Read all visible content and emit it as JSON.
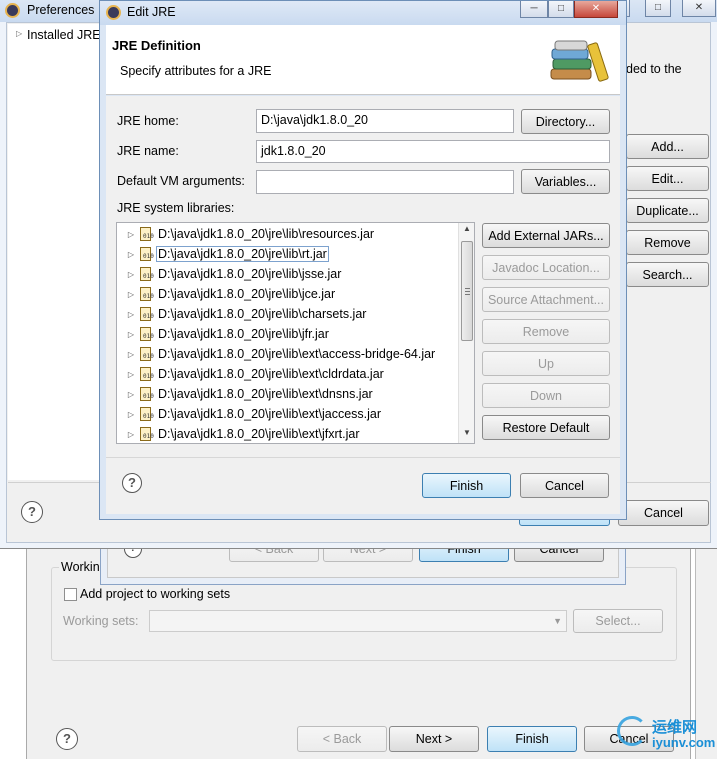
{
  "bg_wizard": {
    "working_sets_group": "Workin",
    "add_project_checkbox": "Add project to working sets",
    "working_sets_label": "Working sets:",
    "select_button": "Select...",
    "back_button": "< Back",
    "next_button": "Next >",
    "finish_button": "Finish",
    "cancel_button": "Cancel"
  },
  "bg_middle": {
    "back_button": "< Back",
    "next_button": "Next >",
    "finish_button": "Finish",
    "cancel_button": "Cancel"
  },
  "preferences": {
    "title": "Preferences",
    "tree_item": "Installed JRE",
    "right_text": "ded to the",
    "add_button": "Add...",
    "edit_button": "Edit...",
    "duplicate_button": "Duplicate...",
    "remove_button": "Remove",
    "search_button": "Search...",
    "cancel_button": "Cancel"
  },
  "edit_jre": {
    "title": "Edit JRE",
    "header_title": "JRE Definition",
    "header_subtitle": "Specify attributes for a JRE",
    "jre_home_label": "JRE home:",
    "jre_home_value": "D:\\java\\jdk1.8.0_20",
    "directory_button": "Directory...",
    "jre_name_label": "JRE name:",
    "jre_name_value": "jdk1.8.0_20",
    "vm_args_label": "Default VM arguments:",
    "vm_args_value": "",
    "variables_button": "Variables...",
    "libraries_label": "JRE system libraries:",
    "libraries": [
      "D:\\java\\jdk1.8.0_20\\jre\\lib\\resources.jar",
      "D:\\java\\jdk1.8.0_20\\jre\\lib\\rt.jar",
      "D:\\java\\jdk1.8.0_20\\jre\\lib\\jsse.jar",
      "D:\\java\\jdk1.8.0_20\\jre\\lib\\jce.jar",
      "D:\\java\\jdk1.8.0_20\\jre\\lib\\charsets.jar",
      "D:\\java\\jdk1.8.0_20\\jre\\lib\\jfr.jar",
      "D:\\java\\jdk1.8.0_20\\jre\\lib\\ext\\access-bridge-64.jar",
      "D:\\java\\jdk1.8.0_20\\jre\\lib\\ext\\cldrdata.jar",
      "D:\\java\\jdk1.8.0_20\\jre\\lib\\ext\\dnsns.jar",
      "D:\\java\\jdk1.8.0_20\\jre\\lib\\ext\\jaccess.jar",
      "D:\\java\\jdk1.8.0_20\\jre\\lib\\ext\\jfxrt.jar"
    ],
    "selected_library_index": 1,
    "add_external_jars_button": "Add External JARs...",
    "javadoc_location_button": "Javadoc Location...",
    "source_attachment_button": "Source Attachment...",
    "remove_button": "Remove",
    "up_button": "Up",
    "down_button": "Down",
    "restore_default_button": "Restore Default",
    "finish_button": "Finish",
    "cancel_button": "Cancel"
  },
  "watermark": {
    "chinese": "运维网",
    "url": "iyunv.com"
  },
  "colors": {
    "title_bar": "#c9daf0",
    "dialog_bg": "#f0f0f0",
    "default_button": "#bfe2f7",
    "selection_border": "#7da2ce"
  }
}
